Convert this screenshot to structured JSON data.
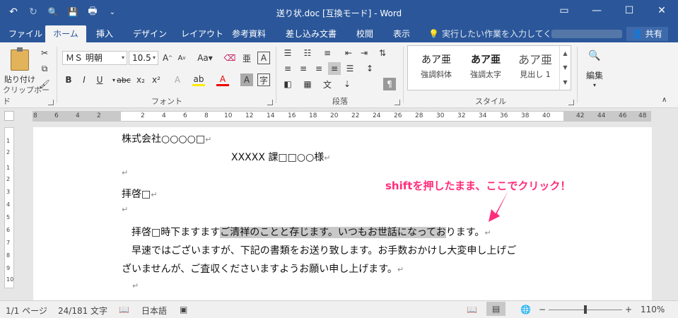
{
  "window": {
    "title": "送り状.doc [互換モード] - Word",
    "controls": [
      "▭",
      "—",
      "☐",
      "✕"
    ]
  },
  "qat": {
    "undo": "↶",
    "redo": "↻",
    "preview": "🔍",
    "save": "💾",
    "print": "🖶",
    "more": "⌄"
  },
  "tabs": [
    {
      "label": "ファイル",
      "active": false
    },
    {
      "label": "ホーム",
      "active": true
    },
    {
      "label": "挿入",
      "active": false
    },
    {
      "label": "デザイン",
      "active": false
    },
    {
      "label": "レイアウト",
      "active": false
    },
    {
      "label": "参考資料",
      "active": false
    },
    {
      "label": "差し込み文書",
      "active": false
    },
    {
      "label": "校閲",
      "active": false
    },
    {
      "label": "表示",
      "active": false
    }
  ],
  "tellme": "実行したい作業を入力してくださ",
  "share": "共有",
  "clipboard": {
    "paste_label": "貼り付け",
    "group_label": "クリップボード"
  },
  "font": {
    "name": "ＭＳ 明朝",
    "size": "10.5",
    "group_label": "フォント"
  },
  "paragraph": {
    "group_label": "段落"
  },
  "styles": {
    "items": [
      {
        "sample": "あア亜",
        "name": "強調斜体"
      },
      {
        "sample": "あア亜",
        "name": "強調太字"
      },
      {
        "sample": "あア亜",
        "name": "見出し 1"
      }
    ],
    "group_label": "スタイル"
  },
  "editing": {
    "label": "編集"
  },
  "ruler": {
    "ticks": [
      "8",
      "6",
      "4",
      "2",
      "2",
      "4",
      "6",
      "8",
      "10",
      "12",
      "14",
      "16",
      "18",
      "20",
      "22",
      "24",
      "26",
      "28",
      "30",
      "32",
      "34",
      "36",
      "38",
      "40",
      "42",
      "44",
      "46",
      "48"
    ],
    "vticks": [
      "1",
      "2",
      "1",
      "2",
      "3",
      "4",
      "5",
      "6",
      "7",
      "8",
      "9",
      "10"
    ]
  },
  "document": {
    "line1": "株式会社○○○○□",
    "line2": "XXXXX 課□□○○様",
    "line4": "拝啓□",
    "line6_pre": "　拝啓□時下ますます",
    "line6_hl": "ご清祥のことと存じます。いつもお世話になってお",
    "line6_post": "ります。",
    "line7": "　早速ではございますが、下記の書類をお送り致します。お手数おかけし大変申し上げご",
    "line8": "ざいませんが、ご査収くださいますようお願い申し上げます。",
    "para_mark": "↵"
  },
  "annotation": {
    "text": "shiftを押したまま、ここでクリック！",
    "color": "#ff2d7a"
  },
  "status": {
    "page": "1/1 ページ",
    "words": "24/181 文字",
    "language": "日本語",
    "zoom": "110%",
    "zoom_minus": "−",
    "zoom_plus": "+"
  },
  "colors": {
    "accent": "#2b579a",
    "highlight": "#c8c8c8"
  }
}
